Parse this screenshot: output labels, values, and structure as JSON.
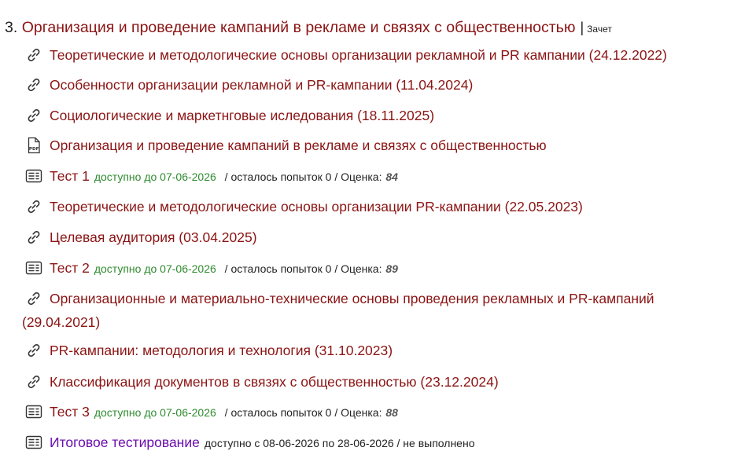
{
  "section": {
    "number": "3.",
    "title": "Организация и проведение кампаний в рекламе и связях с общественностью",
    "separator": "|",
    "tag": "Зачет"
  },
  "items": [
    {
      "icon": "link-icon",
      "text": "Теоретические и методологические основы организации рекламной и PR кампании (24.12.2022)"
    },
    {
      "icon": "link-icon",
      "text": "Особенности организации рекламной и PR-кампании (11.04.2024)"
    },
    {
      "icon": "link-icon",
      "text": "Социологические и маркетнговые иследования (18.11.2025)"
    },
    {
      "icon": "pdf-file-icon",
      "text": "Организация и проведение кампаний в рекламе и связях с общественностью"
    },
    {
      "icon": "test-list-icon",
      "text": "Тест 1",
      "availability": "доступно до 07-06-2026",
      "meta": "/ осталось попыток 0 / Оценка:",
      "score": "84"
    },
    {
      "icon": "link-icon",
      "text": "Теоретические и методологические основы организации PR-кампании (22.05.2023)"
    },
    {
      "icon": "link-icon",
      "text": "Целевая аудитория (03.04.2025)"
    },
    {
      "icon": "test-list-icon",
      "text": "Тест 2",
      "availability": "доступно до 07-06-2026",
      "meta": "/ осталось попыток 0 / Оценка:",
      "score": "89"
    },
    {
      "icon": "link-icon",
      "text": "Организационные и материально-технические основы проведения рекламных и PR-кампаний",
      "continuation": "(29.04.2021)"
    },
    {
      "icon": "link-icon",
      "text": "PR-кампании: методология и технология (31.10.2023)"
    },
    {
      "icon": "link-icon",
      "text": "Классификация документов в связях с общественностью (23.12.2024)"
    },
    {
      "icon": "test-list-icon",
      "text": "Тест 3",
      "availability": "доступно до 07-06-2026",
      "meta": "/ осталось попыток 0 / Оценка:",
      "score": "88"
    },
    {
      "icon": "test-list-icon",
      "text": "Итоговое тестирование",
      "meta": "доступно с 08-06-2026 по 28-06-2026 / не выполнено"
    }
  ],
  "colors": {
    "link": "#8b1414",
    "final_link": "#6a0dad",
    "available": "#2e8b2e"
  }
}
